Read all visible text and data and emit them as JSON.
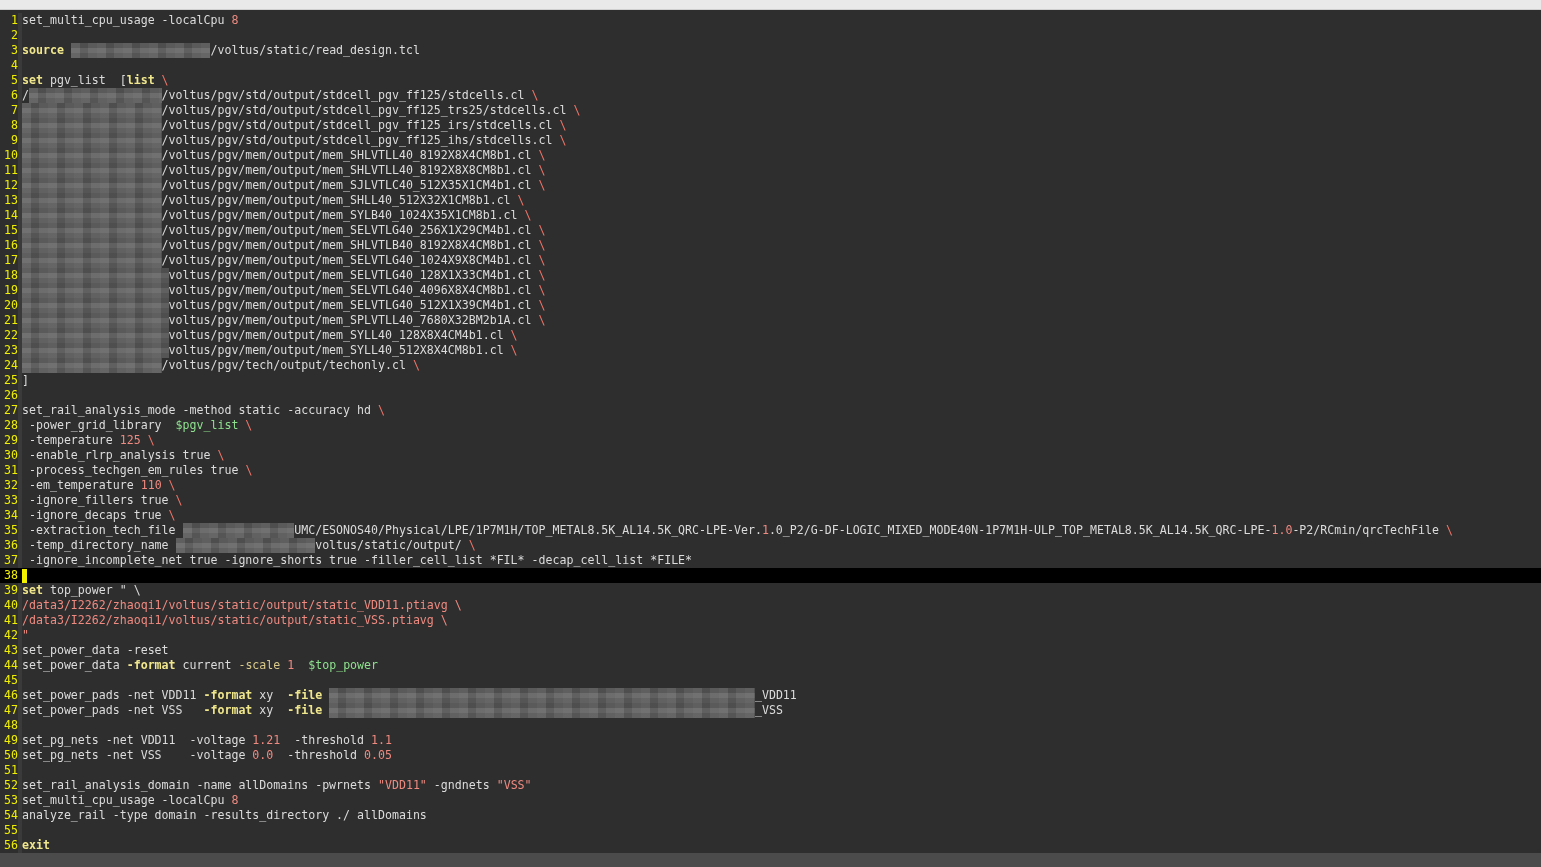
{
  "editor": {
    "lines": [
      {
        "number": "1",
        "current": false,
        "tokens": [
          {
            "kind": "plain",
            "text": "set_multi_cpu_usage -localCpu "
          },
          {
            "kind": "number",
            "text": "8"
          }
        ]
      },
      {
        "number": "2",
        "current": false
      },
      {
        "number": "3",
        "current": false,
        "tokens": [
          {
            "kind": "keyword",
            "text": "source "
          },
          {
            "kind": "redacted"
          },
          {
            "kind": "plain",
            "text": "/voltus/static/read_design.tcl"
          }
        ]
      },
      {
        "number": "4",
        "current": false
      },
      {
        "number": "5",
        "current": false,
        "tokens": [
          {
            "kind": "keyword",
            "text": "set"
          },
          {
            "kind": "plain",
            "text": " pgv_list  ["
          },
          {
            "kind": "keyword",
            "text": "list"
          },
          {
            "kind": "escape",
            "text": " \\"
          }
        ]
      },
      {
        "number": "6",
        "current": false,
        "tokens": [
          {
            "kind": "plain",
            "text": "/"
          },
          {
            "kind": "redacted"
          },
          {
            "kind": "plain",
            "text": "/voltus/pgv/std/output/stdcell_pgv_ff125/stdcells.cl "
          },
          {
            "kind": "escape",
            "text": "\\"
          }
        ]
      },
      {
        "number": "7",
        "current": false,
        "tokens": [
          {
            "kind": "redacted"
          },
          {
            "kind": "plain",
            "text": "/voltus/pgv/std/output/stdcell_pgv_ff125_trs25/stdcells.cl "
          },
          {
            "kind": "escape",
            "text": "\\"
          }
        ]
      },
      {
        "number": "8",
        "current": false,
        "tokens": [
          {
            "kind": "redacted"
          },
          {
            "kind": "plain",
            "text": "/voltus/pgv/std/output/stdcell_pgv_ff125_irs/stdcells.cl "
          },
          {
            "kind": "escape",
            "text": "\\"
          }
        ]
      },
      {
        "number": "9",
        "current": false,
        "tokens": [
          {
            "kind": "redacted"
          },
          {
            "kind": "plain",
            "text": "/voltus/pgv/std/output/stdcell_pgv_ff125_ihs/stdcells.cl "
          },
          {
            "kind": "escape",
            "text": "\\"
          }
        ]
      },
      {
        "number": "10",
        "current": false,
        "tokens": [
          {
            "kind": "redacted"
          },
          {
            "kind": "plain",
            "text": "/voltus/pgv/mem/output/mem_SHLVTLL40_8192X8X4CM8b1.cl "
          },
          {
            "kind": "escape",
            "text": "\\"
          }
        ]
      },
      {
        "number": "11",
        "current": false,
        "tokens": [
          {
            "kind": "redacted"
          },
          {
            "kind": "plain",
            "text": "/voltus/pgv/mem/output/mem_SHLVTLL40_8192X8X8CM8b1.cl "
          },
          {
            "kind": "escape",
            "text": "\\"
          }
        ]
      },
      {
        "number": "12",
        "current": false,
        "tokens": [
          {
            "kind": "redacted"
          },
          {
            "kind": "plain",
            "text": "/voltus/pgv/mem/output/mem_SJLVTLC40_512X35X1CM4b1.cl "
          },
          {
            "kind": "escape",
            "text": "\\"
          }
        ]
      },
      {
        "number": "13",
        "current": false,
        "tokens": [
          {
            "kind": "redacted"
          },
          {
            "kind": "plain",
            "text": "/voltus/pgv/mem/output/mem_SHLL40_512X32X1CM8b1.cl "
          },
          {
            "kind": "escape",
            "text": "\\"
          }
        ]
      },
      {
        "number": "14",
        "current": false,
        "tokens": [
          {
            "kind": "redacted"
          },
          {
            "kind": "plain",
            "text": "/voltus/pgv/mem/output/mem_SYLB40_1024X35X1CM8b1.cl "
          },
          {
            "kind": "escape",
            "text": "\\"
          }
        ]
      },
      {
        "number": "15",
        "current": false,
        "tokens": [
          {
            "kind": "redacted"
          },
          {
            "kind": "plain",
            "text": "/voltus/pgv/mem/output/mem_SELVTLG40_256X1X29CM4b1.cl "
          },
          {
            "kind": "escape",
            "text": "\\"
          }
        ]
      },
      {
        "number": "16",
        "current": false,
        "tokens": [
          {
            "kind": "redacted"
          },
          {
            "kind": "plain",
            "text": "/voltus/pgv/mem/output/mem_SHLVTLB40_8192X8X4CM8b1.cl "
          },
          {
            "kind": "escape",
            "text": "\\"
          }
        ]
      },
      {
        "number": "17",
        "current": false,
        "tokens": [
          {
            "kind": "redacted"
          },
          {
            "kind": "plain",
            "text": "/voltus/pgv/mem/output/mem_SELVTLG40_1024X9X8CM4b1.cl "
          },
          {
            "kind": "escape",
            "text": "\\"
          }
        ]
      },
      {
        "number": "18",
        "current": false,
        "tokens": [
          {
            "kind": "redacted"
          },
          {
            "kind": "plain",
            "text": "voltus/pgv/mem/output/mem_SELVTLG40_128X1X33CM4b1.cl "
          },
          {
            "kind": "escape",
            "text": "\\"
          }
        ]
      },
      {
        "number": "19",
        "current": false,
        "tokens": [
          {
            "kind": "redacted"
          },
          {
            "kind": "plain",
            "text": "voltus/pgv/mem/output/mem_SELVTLG40_4096X8X4CM8b1.cl "
          },
          {
            "kind": "escape",
            "text": "\\"
          }
        ]
      },
      {
        "number": "20",
        "current": false,
        "tokens": [
          {
            "kind": "redacted"
          },
          {
            "kind": "plain",
            "text": "voltus/pgv/mem/output/mem_SELVTLG40_512X1X39CM4b1.cl "
          },
          {
            "kind": "escape",
            "text": "\\"
          }
        ]
      },
      {
        "number": "21",
        "current": false,
        "tokens": [
          {
            "kind": "redacted"
          },
          {
            "kind": "plain",
            "text": "voltus/pgv/mem/output/mem_SPLVTLL40_7680X32BM2b1A.cl "
          },
          {
            "kind": "escape",
            "text": "\\"
          }
        ]
      },
      {
        "number": "22",
        "current": false,
        "tokens": [
          {
            "kind": "redacted"
          },
          {
            "kind": "plain",
            "text": "voltus/pgv/mem/output/mem_SYLL40_128X8X4CM4b1.cl "
          },
          {
            "kind": "escape",
            "text": "\\"
          }
        ]
      },
      {
        "number": "23",
        "current": false,
        "tokens": [
          {
            "kind": "redacted"
          },
          {
            "kind": "plain",
            "text": "voltus/pgv/mem/output/mem_SYLL40_512X8X4CM8b1.cl "
          },
          {
            "kind": "escape",
            "text": "\\"
          }
        ]
      },
      {
        "number": "24",
        "current": false,
        "tokens": [
          {
            "kind": "redacted"
          },
          {
            "kind": "plain",
            "text": "/voltus/pgv/tech/output/techonly.cl "
          },
          {
            "kind": "escape",
            "text": "\\"
          }
        ]
      },
      {
        "number": "25",
        "current": false,
        "tokens": [
          {
            "kind": "plain",
            "text": "]"
          }
        ]
      },
      {
        "number": "26",
        "current": false
      },
      {
        "number": "27",
        "current": false,
        "tokens": [
          {
            "kind": "plain",
            "text": "set_rail_analysis_mode -method static -accuracy hd "
          },
          {
            "kind": "escape",
            "text": "\\"
          }
        ]
      },
      {
        "number": "28",
        "current": false,
        "tokens": [
          {
            "kind": "plain",
            "text": " -power_grid_library  "
          },
          {
            "kind": "variable",
            "text": "$pgv_list"
          },
          {
            "kind": "escape",
            "text": " \\"
          }
        ]
      },
      {
        "number": "29",
        "current": false,
        "tokens": [
          {
            "kind": "plain",
            "text": " -temperature "
          },
          {
            "kind": "number",
            "text": "125"
          },
          {
            "kind": "escape",
            "text": " \\"
          }
        ]
      },
      {
        "number": "30",
        "current": false,
        "tokens": [
          {
            "kind": "plain",
            "text": " -enable_rlrp_analysis true "
          },
          {
            "kind": "escape",
            "text": "\\"
          }
        ]
      },
      {
        "number": "31",
        "current": false,
        "tokens": [
          {
            "kind": "plain",
            "text": " -process_techgen_em_rules true "
          },
          {
            "kind": "escape",
            "text": "\\"
          }
        ]
      },
      {
        "number": "32",
        "current": false,
        "tokens": [
          {
            "kind": "plain",
            "text": " -em_temperature "
          },
          {
            "kind": "number",
            "text": "110"
          },
          {
            "kind": "escape",
            "text": " \\"
          }
        ]
      },
      {
        "number": "33",
        "current": false,
        "tokens": [
          {
            "kind": "plain",
            "text": " -ignore_fillers true "
          },
          {
            "kind": "escape",
            "text": "\\"
          }
        ]
      },
      {
        "number": "34",
        "current": false,
        "tokens": [
          {
            "kind": "plain",
            "text": " -ignore_decaps true "
          },
          {
            "kind": "escape",
            "text": "\\"
          }
        ]
      },
      {
        "number": "35",
        "current": false,
        "tokens": [
          {
            "kind": "plain",
            "text": " -extraction_tech_file "
          },
          {
            "kind": "redacted"
          },
          {
            "kind": "plain",
            "text": "UMC/ESONOS40/Physical/LPE/1P7M1H/TOP_METAL8.5K_AL14.5K_QRC-LPE-Ver."
          },
          {
            "kind": "number",
            "text": "1"
          },
          {
            "kind": "plain",
            "text": ".0_P2/G-DF-LOGIC_MIXED_MODE40N-1P7M1H-ULP_TOP_METAL8.5K_AL14.5K_QRC-LPE-"
          },
          {
            "kind": "number",
            "text": "1.0"
          },
          {
            "kind": "plain",
            "text": "-P2/RCmin/qrcTechFile "
          },
          {
            "kind": "escape",
            "text": "\\"
          }
        ]
      },
      {
        "number": "36",
        "current": false,
        "tokens": [
          {
            "kind": "plain",
            "text": " -temp_directory_name "
          },
          {
            "kind": "redacted"
          },
          {
            "kind": "plain",
            "text": "voltus/static/output/ "
          },
          {
            "kind": "escape",
            "text": "\\"
          }
        ]
      },
      {
        "number": "37",
        "current": false,
        "tokens": [
          {
            "kind": "plain",
            "text": " -ignore_incomplete_net true -ignore_shorts true -filler_cell_list *FIL* -decap_cell_list *FILE*"
          }
        ]
      },
      {
        "number": "38",
        "current": true
      },
      {
        "number": "39",
        "current": false,
        "tokens": [
          {
            "kind": "keyword",
            "text": "set"
          },
          {
            "kind": "plain",
            "text": " top_power \" \\"
          }
        ]
      },
      {
        "number": "40",
        "current": false,
        "tokens": [
          {
            "kind": "string",
            "text": "/data3/I2262/zhaoqi1/voltus/static/output/static_VDD11.ptiavg \\"
          }
        ]
      },
      {
        "number": "41",
        "current": false,
        "tokens": [
          {
            "kind": "string",
            "text": "/data3/I2262/zhaoqi1/voltus/static/output/static_VSS.ptiavg \\"
          }
        ]
      },
      {
        "number": "42",
        "current": false,
        "tokens": [
          {
            "kind": "string",
            "text": "\""
          }
        ]
      },
      {
        "number": "43",
        "current": false,
        "tokens": [
          {
            "kind": "plain",
            "text": "set_power_data -reset"
          }
        ]
      },
      {
        "number": "44",
        "current": false,
        "tokens": [
          {
            "kind": "plain",
            "text": "set_power_data "
          },
          {
            "kind": "keyword",
            "text": "-format"
          },
          {
            "kind": "plain",
            "text": " current "
          },
          {
            "kind": "option",
            "text": "-scale "
          },
          {
            "kind": "number",
            "text": "1"
          },
          {
            "kind": "variable",
            "text": "  $top_power"
          }
        ]
      },
      {
        "number": "45",
        "current": false
      },
      {
        "number": "46",
        "current": false,
        "tokens": [
          {
            "kind": "plain",
            "text": "set_power_pads -net VDD11 "
          },
          {
            "kind": "keyword",
            "text": "-format"
          },
          {
            "kind": "plain",
            "text": " xy  "
          },
          {
            "kind": "keyword",
            "text": "-file "
          },
          {
            "kind": "redacted"
          },
          {
            "kind": "plain",
            "text": "_VDD11"
          }
        ]
      },
      {
        "number": "47",
        "current": false,
        "tokens": [
          {
            "kind": "plain",
            "text": "set_power_pads -net VSS   "
          },
          {
            "kind": "keyword",
            "text": "-format"
          },
          {
            "kind": "plain",
            "text": " xy  "
          },
          {
            "kind": "keyword",
            "text": "-file "
          },
          {
            "kind": "redacted"
          },
          {
            "kind": "plain",
            "text": "_VSS"
          }
        ]
      },
      {
        "number": "48",
        "current": false
      },
      {
        "number": "49",
        "current": false,
        "tokens": [
          {
            "kind": "plain",
            "text": "set_pg_nets -net VDD11  -voltage "
          },
          {
            "kind": "number",
            "text": "1.21"
          },
          {
            "kind": "plain",
            "text": "  -threshold "
          },
          {
            "kind": "number",
            "text": "1.1"
          }
        ]
      },
      {
        "number": "50",
        "current": false,
        "tokens": [
          {
            "kind": "plain",
            "text": "set_pg_nets -net VSS    -voltage "
          },
          {
            "kind": "number",
            "text": "0.0"
          },
          {
            "kind": "plain",
            "text": "  -threshold "
          },
          {
            "kind": "number",
            "text": "0.05"
          }
        ]
      },
      {
        "number": "51",
        "current": false
      },
      {
        "number": "52",
        "current": false,
        "tokens": [
          {
            "kind": "plain",
            "text": "set_rail_analysis_domain -name allDomains -pwrnets "
          },
          {
            "kind": "string",
            "text": "\"VDD11\""
          },
          {
            "kind": "plain",
            "text": " -gndnets "
          },
          {
            "kind": "string",
            "text": "\"VSS\""
          }
        ]
      },
      {
        "number": "53",
        "current": false,
        "tokens": [
          {
            "kind": "plain",
            "text": "set_multi_cpu_usage -localCpu "
          },
          {
            "kind": "number",
            "text": "8"
          }
        ]
      },
      {
        "number": "54",
        "current": false,
        "tokens": [
          {
            "kind": "plain",
            "text": "analyze_rail -type domain -results_directory ./ allDomains"
          }
        ]
      },
      {
        "number": "55",
        "current": false
      },
      {
        "number": "56",
        "current": false,
        "tokens": [
          {
            "kind": "keyword",
            "text": "exit"
          }
        ]
      }
    ]
  }
}
